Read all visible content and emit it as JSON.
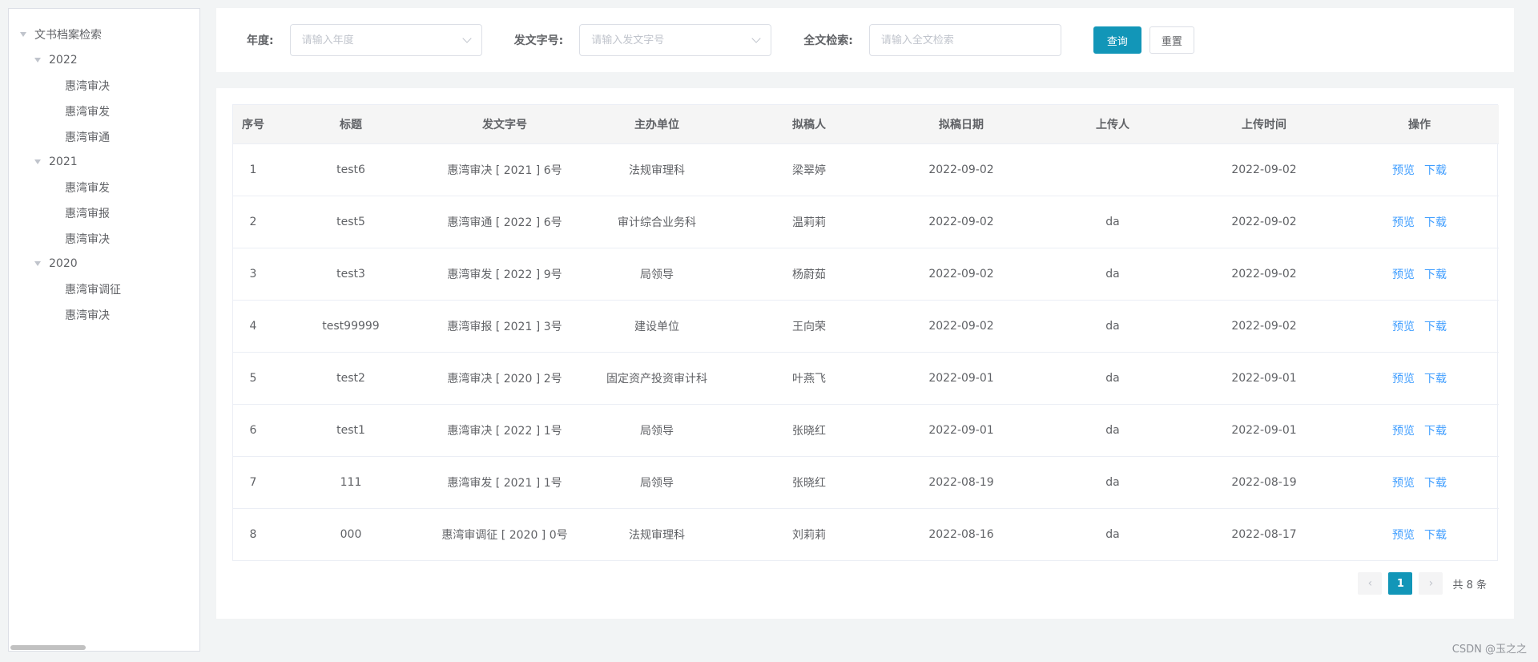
{
  "sidebar": {
    "root_label": "文书档案检索",
    "groups": [
      {
        "year": "2022",
        "items": [
          "惠湾审决",
          "惠湾审发",
          "惠湾审通"
        ]
      },
      {
        "year": "2021",
        "items": [
          "惠湾审发",
          "惠湾审报",
          "惠湾审决"
        ]
      },
      {
        "year": "2020",
        "items": [
          "惠湾审调征",
          "惠湾审决"
        ]
      }
    ]
  },
  "search": {
    "year_label": "年度:",
    "year_placeholder": "请输入年度",
    "docno_label": "发文字号:",
    "docno_placeholder": "请输入发文字号",
    "fulltext_label": "全文检索:",
    "fulltext_placeholder": "请输入全文检索",
    "query_label": "查询",
    "reset_label": "重置"
  },
  "table": {
    "headers": [
      "序号",
      "标题",
      "发文字号",
      "主办单位",
      "拟稿人",
      "拟稿日期",
      "上传人",
      "上传时间",
      "操作"
    ],
    "preview_label": "预览",
    "download_label": "下载",
    "rows": [
      [
        "1",
        "test6",
        "惠湾审决 [ 2021 ] 6号",
        "法规审理科",
        "梁翠婷",
        "2022-09-02",
        "",
        "2022-09-02"
      ],
      [
        "2",
        "test5",
        "惠湾审通 [ 2022 ] 6号",
        "审计综合业务科",
        "温莉莉",
        "2022-09-02",
        "da",
        "2022-09-02"
      ],
      [
        "3",
        "test3",
        "惠湾审发 [ 2022 ] 9号",
        "局领导",
        "杨蔚茹",
        "2022-09-02",
        "da",
        "2022-09-02"
      ],
      [
        "4",
        "test99999",
        "惠湾审报 [ 2021 ] 3号",
        "建设单位",
        "王向荣",
        "2022-09-02",
        "da",
        "2022-09-02"
      ],
      [
        "5",
        "test2",
        "惠湾审决 [ 2020 ] 2号",
        "固定资产投资审计科",
        "叶燕飞",
        "2022-09-01",
        "da",
        "2022-09-01"
      ],
      [
        "6",
        "test1",
        "惠湾审决 [ 2022 ] 1号",
        "局领导",
        "张晓红",
        "2022-09-01",
        "da",
        "2022-09-01"
      ],
      [
        "7",
        "111",
        "惠湾审发 [ 2021 ] 1号",
        "局领导",
        "张晓红",
        "2022-08-19",
        "da",
        "2022-08-19"
      ],
      [
        "8",
        "000",
        "惠湾审调征 [ 2020 ] 0号",
        "法规审理科",
        "刘莉莉",
        "2022-08-16",
        "da",
        "2022-08-17"
      ]
    ]
  },
  "pagination": {
    "prev_icon": "‹",
    "next_icon": "›",
    "current_page": "1",
    "total_text": "共 8 条"
  },
  "watermark": "CSDN @玉之之",
  "colors": {
    "primary": "#1296b8",
    "link": "#409eff"
  }
}
